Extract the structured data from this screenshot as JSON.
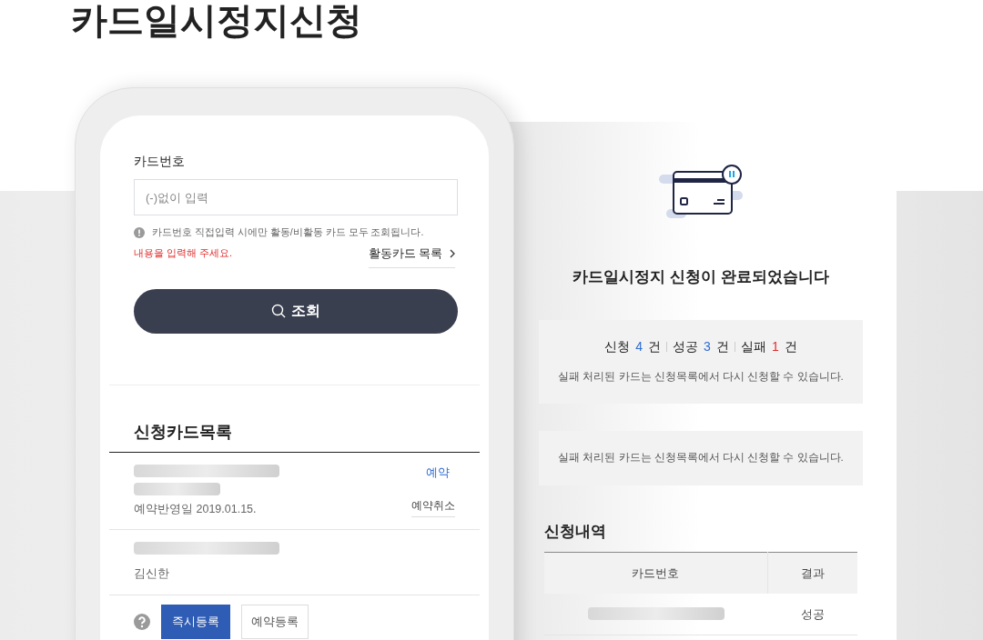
{
  "page_title": "카드일시정지신청",
  "lookup": {
    "label": "카드번호",
    "placeholder": "(-)없이 입력",
    "note": "카드번호 직접입력 시에만 활동/비활동 카드 모두 조회됩니다.",
    "error": "내용을 입력해 주세요.",
    "link": "활동카드 목록",
    "search_button": "조회"
  },
  "card_list": {
    "title": "신청카드목록",
    "items": [
      {
        "status": "예약",
        "detail": "예약반영일 2019.01.15.",
        "action": "예약취소"
      },
      {
        "owner": "김신한"
      }
    ]
  },
  "register_buttons": [
    {
      "label": "즉시등록",
      "selected": true
    },
    {
      "label": "예약등록",
      "selected": false
    }
  ],
  "result": {
    "heading": "카드일시정지 신청이 완료되었습니다",
    "counts": [
      {
        "label": "신청",
        "count": "4",
        "unit": "건",
        "color": "#2f6bd0"
      },
      {
        "label": "성공",
        "count": "3",
        "unit": "건",
        "color": "#2f6bd0"
      },
      {
        "label": "실패",
        "count": "1",
        "unit": "건",
        "color": "#e02b2b"
      }
    ],
    "notice": "실패 처리된 카드는 신청목록에서 다시 신청할 수 있습니다.",
    "notice_2": "실패 처리된 카드는 신청목록에서 다시 신청할 수 있습니다.",
    "history_title": "신청내역",
    "table": {
      "columns": [
        "카드번호",
        "결과"
      ],
      "rows": [
        {
          "result": "성공"
        }
      ]
    }
  }
}
